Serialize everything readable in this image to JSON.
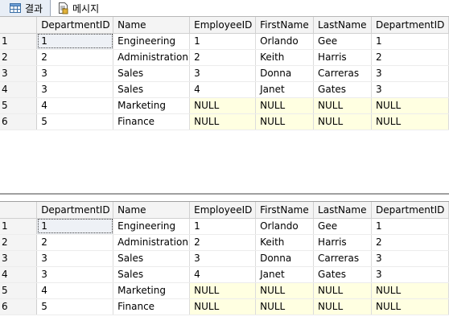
{
  "tabs": {
    "results": {
      "label": "결과",
      "icon": "grid-icon"
    },
    "messages": {
      "label": "메시지",
      "icon": "message-icon"
    }
  },
  "columns": [
    "DepartmentID",
    "Name",
    "EmployeeID",
    "FirstName",
    "LastName",
    "DepartmentID"
  ],
  "null_text": "NULL",
  "colors": {
    "null_cell": "#ffffe1",
    "header_bg": "#f4f4f4"
  },
  "grid1": {
    "rows": [
      {
        "num": "1",
        "cells": [
          "1",
          "Engineering",
          "1",
          "Orlando",
          "Gee",
          "1"
        ]
      },
      {
        "num": "2",
        "cells": [
          "2",
          "Administration",
          "2",
          "Keith",
          "Harris",
          "2"
        ]
      },
      {
        "num": "3",
        "cells": [
          "3",
          "Sales",
          "3",
          "Donna",
          "Carreras",
          "3"
        ]
      },
      {
        "num": "4",
        "cells": [
          "3",
          "Sales",
          "4",
          "Janet",
          "Gates",
          "3"
        ]
      },
      {
        "num": "5",
        "cells": [
          "4",
          "Marketing",
          "NULL",
          "NULL",
          "NULL",
          "NULL"
        ]
      },
      {
        "num": "6",
        "cells": [
          "5",
          "Finance",
          "NULL",
          "NULL",
          "NULL",
          "NULL"
        ]
      }
    ]
  },
  "grid2": {
    "rows": [
      {
        "num": "1",
        "cells": [
          "1",
          "Engineering",
          "1",
          "Orlando",
          "Gee",
          "1"
        ]
      },
      {
        "num": "2",
        "cells": [
          "2",
          "Administration",
          "2",
          "Keith",
          "Harris",
          "2"
        ]
      },
      {
        "num": "3",
        "cells": [
          "3",
          "Sales",
          "3",
          "Donna",
          "Carreras",
          "3"
        ]
      },
      {
        "num": "4",
        "cells": [
          "3",
          "Sales",
          "4",
          "Janet",
          "Gates",
          "3"
        ]
      },
      {
        "num": "5",
        "cells": [
          "4",
          "Marketing",
          "NULL",
          "NULL",
          "NULL",
          "NULL"
        ]
      },
      {
        "num": "6",
        "cells": [
          "5",
          "Finance",
          "NULL",
          "NULL",
          "NULL",
          "NULL"
        ]
      }
    ]
  }
}
